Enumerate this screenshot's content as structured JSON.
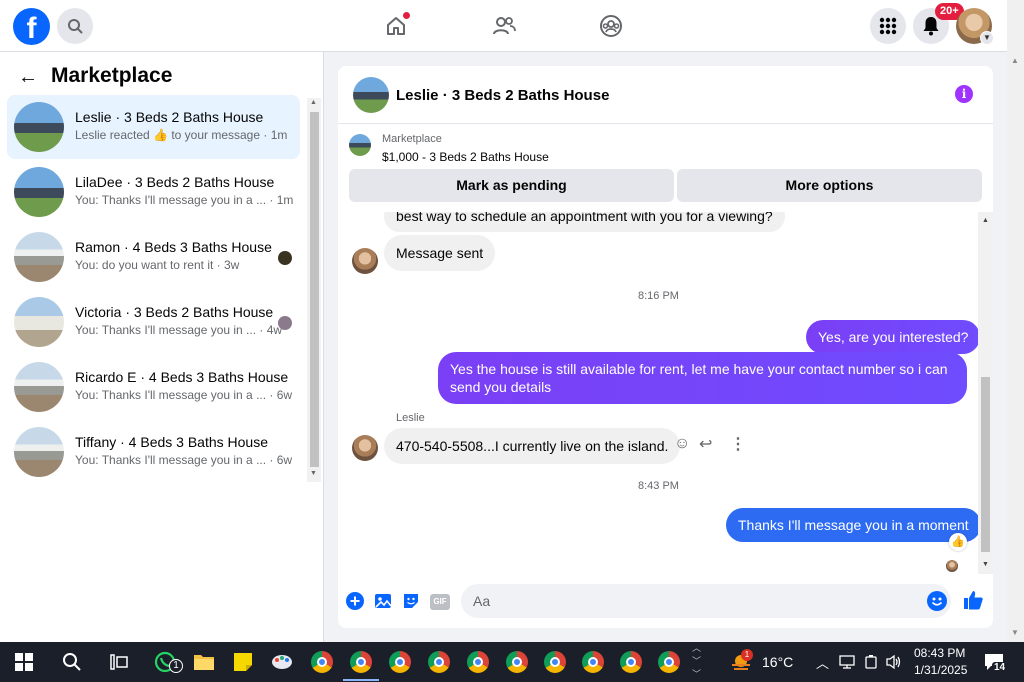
{
  "nav": {
    "logo": "f",
    "notifications_badge": "20+"
  },
  "sidebar": {
    "title": "Marketplace",
    "conversations": [
      {
        "name": "Leslie · 3 Beds 2 Baths House",
        "preview": "Leslie reacted 👍 to your message · 1m",
        "active": true
      },
      {
        "name": "LilaDee · 3 Beds 2 Baths House",
        "preview": "You: Thanks I'll message you in a ... · 1m",
        "active": false
      },
      {
        "name": "Ramon · 4 Beds 3 Baths House",
        "preview": "You: do you want to rent it · 3w",
        "active": false
      },
      {
        "name": "Victoria · 3 Beds 2 Baths House",
        "preview": "You: Thanks I'll message you in ... · 4w",
        "active": false
      },
      {
        "name": "Ricardo E · 4 Beds 3 Baths House",
        "preview": "You: Thanks I'll message you in a ... · 6w",
        "active": false
      },
      {
        "name": "Tiffany · 4 Beds 3 Baths House",
        "preview": "You: Thanks I'll message you in a ... · 6w",
        "active": false
      }
    ]
  },
  "chat": {
    "title": "Leslie · 3 Beds 2 Baths House",
    "listing_category": "Marketplace",
    "listing_price": "$1,000 - 3 Beds 2 Baths House",
    "mark_pending": "Mark as pending",
    "more_options": "More options",
    "messages": {
      "partial": "best way to schedule an appointment with you for a viewing?",
      "message_sent": "Message sent",
      "time1": "8:16 PM",
      "out1": "Yes, are you interested?",
      "out2": "Yes the house is still available for rent, let me have your contact number so i can send you details",
      "sender": "Leslie",
      "in1": "470-540-5508...I currently live on the island.",
      "time2": "8:43 PM",
      "out3": "Thanks I'll message you in a moment"
    },
    "composer_placeholder": "Aa",
    "gif_label": "GIF"
  },
  "taskbar": {
    "weather": "16°C",
    "time": "08:43 PM",
    "date": "1/31/2025",
    "notification_count": "14",
    "whatsapp_count": "1",
    "weather_alert": "1"
  }
}
